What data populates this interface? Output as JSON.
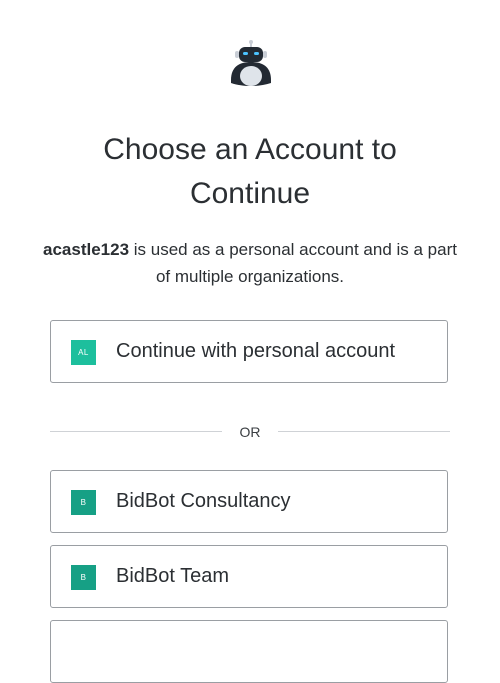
{
  "header": {
    "logo_icon": "robot-icon",
    "title_line1": "Choose an Account to",
    "title_line2": "Continue"
  },
  "description": {
    "username": "acastle123",
    "text": " is used as a personal account and is a part of multiple organizations."
  },
  "personal_account": {
    "badge": "AL",
    "badge_color": "#1dbf9d",
    "label": "Continue with personal account"
  },
  "divider": {
    "label": "OR"
  },
  "organizations": [
    {
      "badge": "B",
      "badge_color": "#16a085",
      "label": "BidBot Consultancy"
    },
    {
      "badge": "B",
      "badge_color": "#16a085",
      "label": "BidBot Team"
    },
    {
      "badge": "",
      "badge_color": "#16a085",
      "label": ""
    }
  ]
}
